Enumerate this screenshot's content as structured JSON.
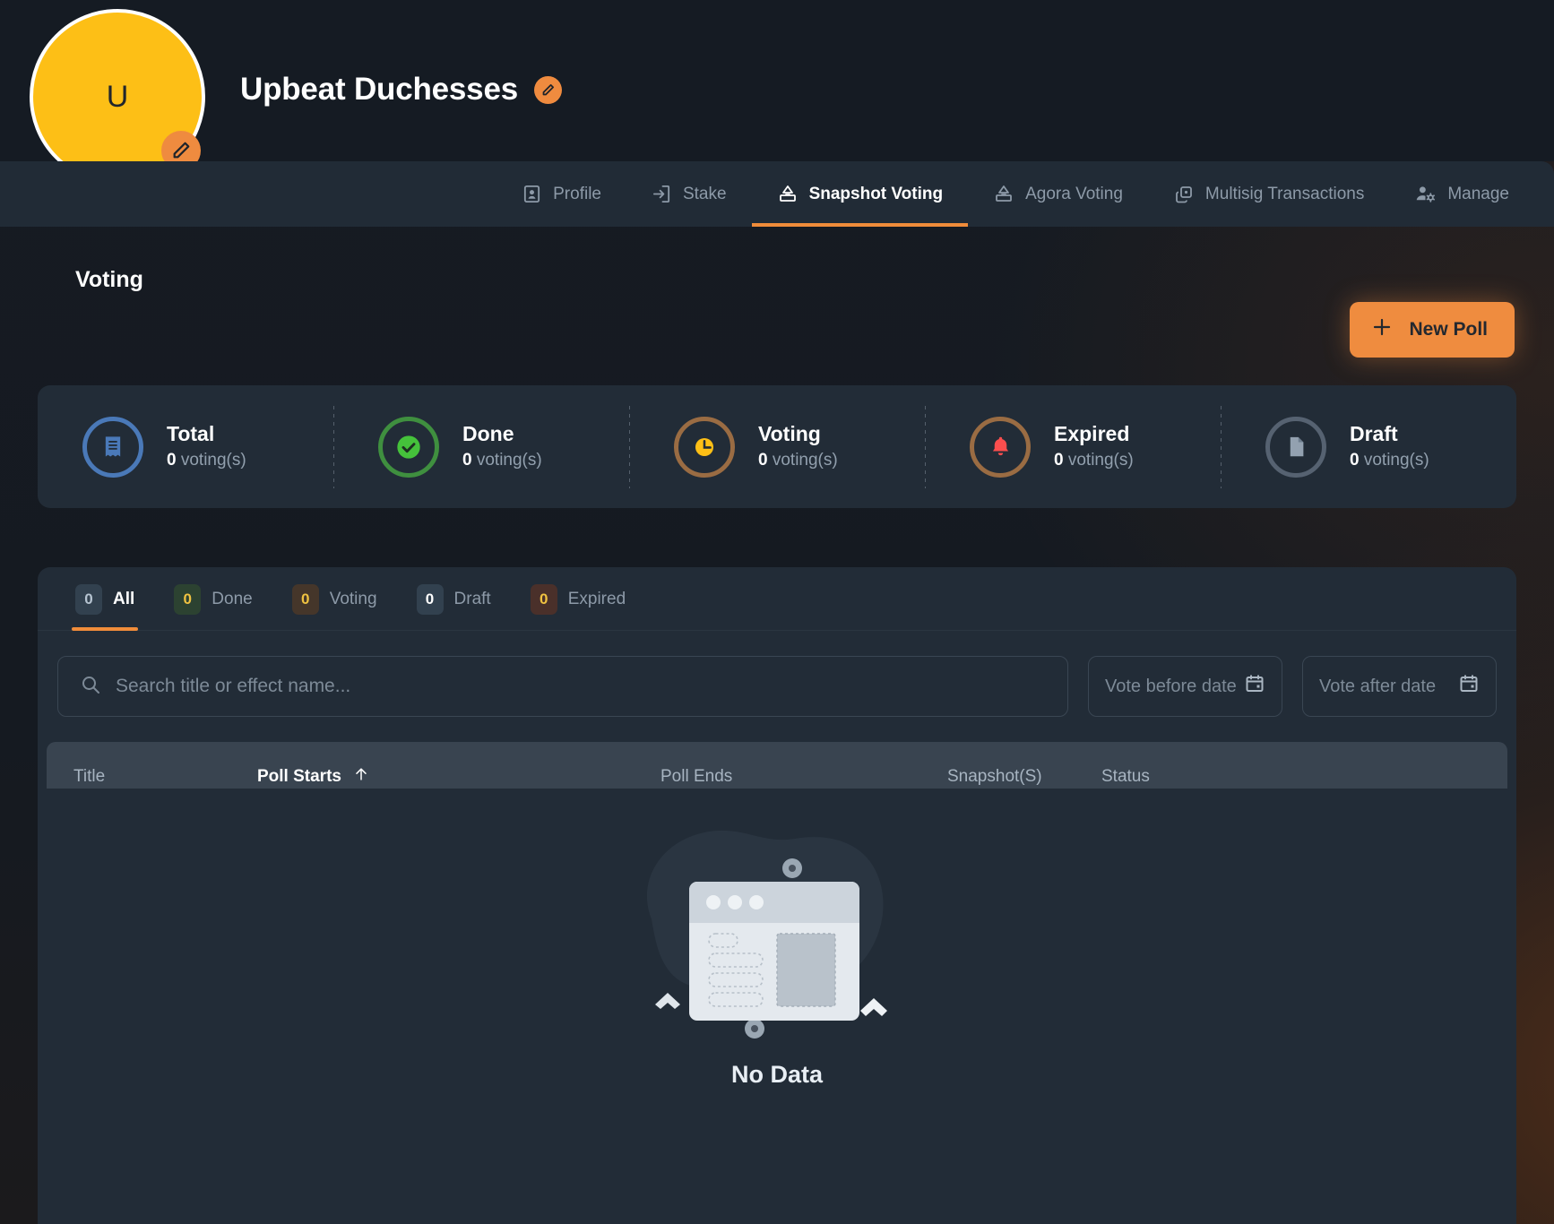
{
  "header": {
    "avatar_initial": "U",
    "org_name": "Upbeat Duchesses",
    "avatar_edit_icon": "pencil-icon",
    "title_edit_icon": "pencil-icon"
  },
  "nav": {
    "items": [
      {
        "label": "Profile",
        "icon": "profile-icon",
        "active": false
      },
      {
        "label": "Stake",
        "icon": "stake-icon",
        "active": false
      },
      {
        "label": "Snapshot Voting",
        "icon": "ballot-box-icon",
        "active": true
      },
      {
        "label": "Agora Voting",
        "icon": "ballot-box-icon",
        "active": false
      },
      {
        "label": "Multisig Transactions",
        "icon": "multisig-icon",
        "active": false
      },
      {
        "label": "Manage",
        "icon": "user-gear-icon",
        "active": false
      }
    ]
  },
  "main": {
    "section_title": "Voting",
    "new_poll_label": "New Poll",
    "new_poll_icon": "plus-icon",
    "accent_color": "#ef8c3f"
  },
  "stats": [
    {
      "label": "Total",
      "count": "0",
      "unit": "voting(s)",
      "icon": "receipt-icon",
      "ring_color": "#4a79b8"
    },
    {
      "label": "Done",
      "count": "0",
      "unit": "voting(s)",
      "icon": "check-circle-icon",
      "ring_color": "#3f8f3f"
    },
    {
      "label": "Voting",
      "count": "0",
      "unit": "voting(s)",
      "icon": "clock-icon",
      "ring_color": "#9a6c43"
    },
    {
      "label": "Expired",
      "count": "0",
      "unit": "voting(s)",
      "icon": "bell-icon",
      "ring_color": "#9a6c43"
    },
    {
      "label": "Draft",
      "count": "0",
      "unit": "voting(s)",
      "icon": "document-icon",
      "ring_color": "#566271"
    }
  ],
  "filter_tabs": [
    {
      "label": "All",
      "count": "0",
      "active": true
    },
    {
      "label": "Done",
      "count": "0",
      "active": false
    },
    {
      "label": "Voting",
      "count": "0",
      "active": false
    },
    {
      "label": "Draft",
      "count": "0",
      "active": false
    },
    {
      "label": "Expired",
      "count": "0",
      "active": false
    }
  ],
  "filters": {
    "search_placeholder": "Search title or effect name...",
    "search_value": "",
    "search_icon": "search-icon",
    "vote_before_label": "Vote before date",
    "vote_after_label": "Vote after date",
    "calendar_icon": "calendar-icon"
  },
  "table": {
    "columns": [
      {
        "label": "Title",
        "sorted": false
      },
      {
        "label": "Poll Starts",
        "sorted": true,
        "sort_icon": "arrow-up-icon"
      },
      {
        "label": "Poll Ends",
        "sorted": false
      },
      {
        "label": "Snapshot(S)",
        "sorted": false
      },
      {
        "label": "Status",
        "sorted": false
      }
    ],
    "rows": []
  },
  "empty_state": {
    "message": "No Data",
    "illustration": "empty-window-illustration"
  }
}
